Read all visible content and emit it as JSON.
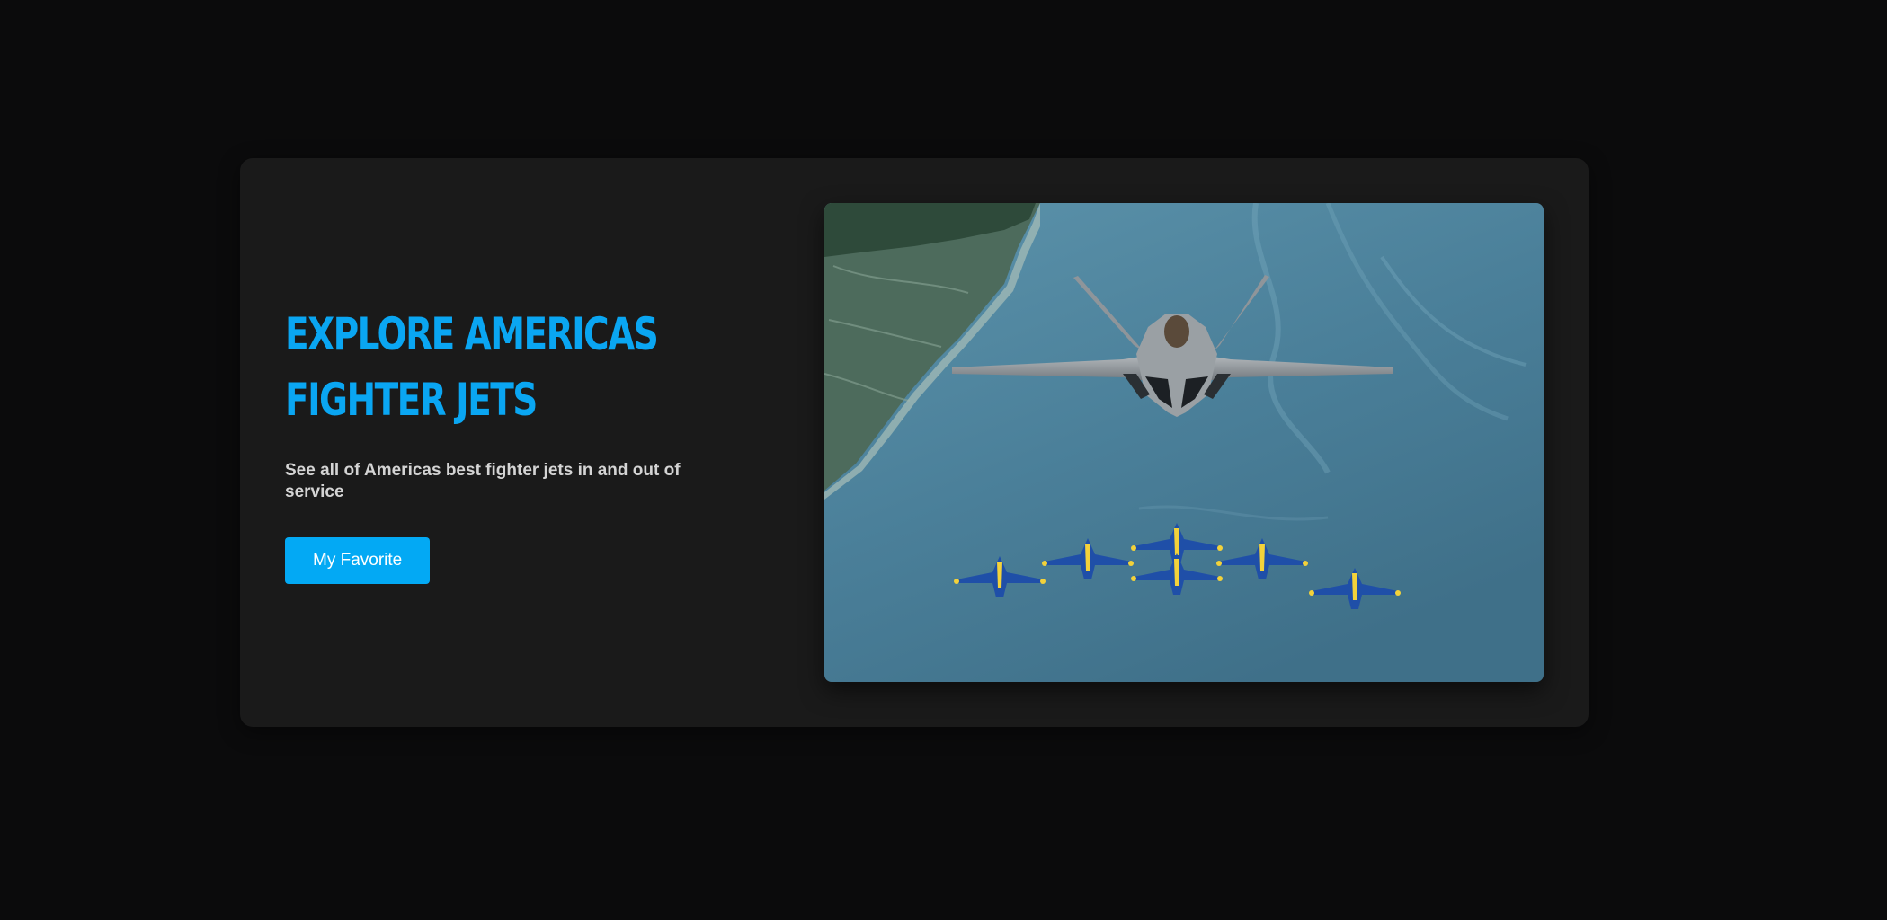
{
  "hero": {
    "headline": "EXPLORE AMERICAS FIGHTER JETS",
    "subtitle": "See all of Americas best fighter jets in and out of service",
    "button_label": "My Favorite"
  },
  "image": {
    "subject": "fighter-jets-formation-photo"
  },
  "colors": {
    "page_bg": "#0b0b0c",
    "card_bg": "#1a1a1a",
    "accent": "#0aa6f2",
    "button_bg": "#03a9f4",
    "subtitle_text": "#d4d4d4"
  }
}
